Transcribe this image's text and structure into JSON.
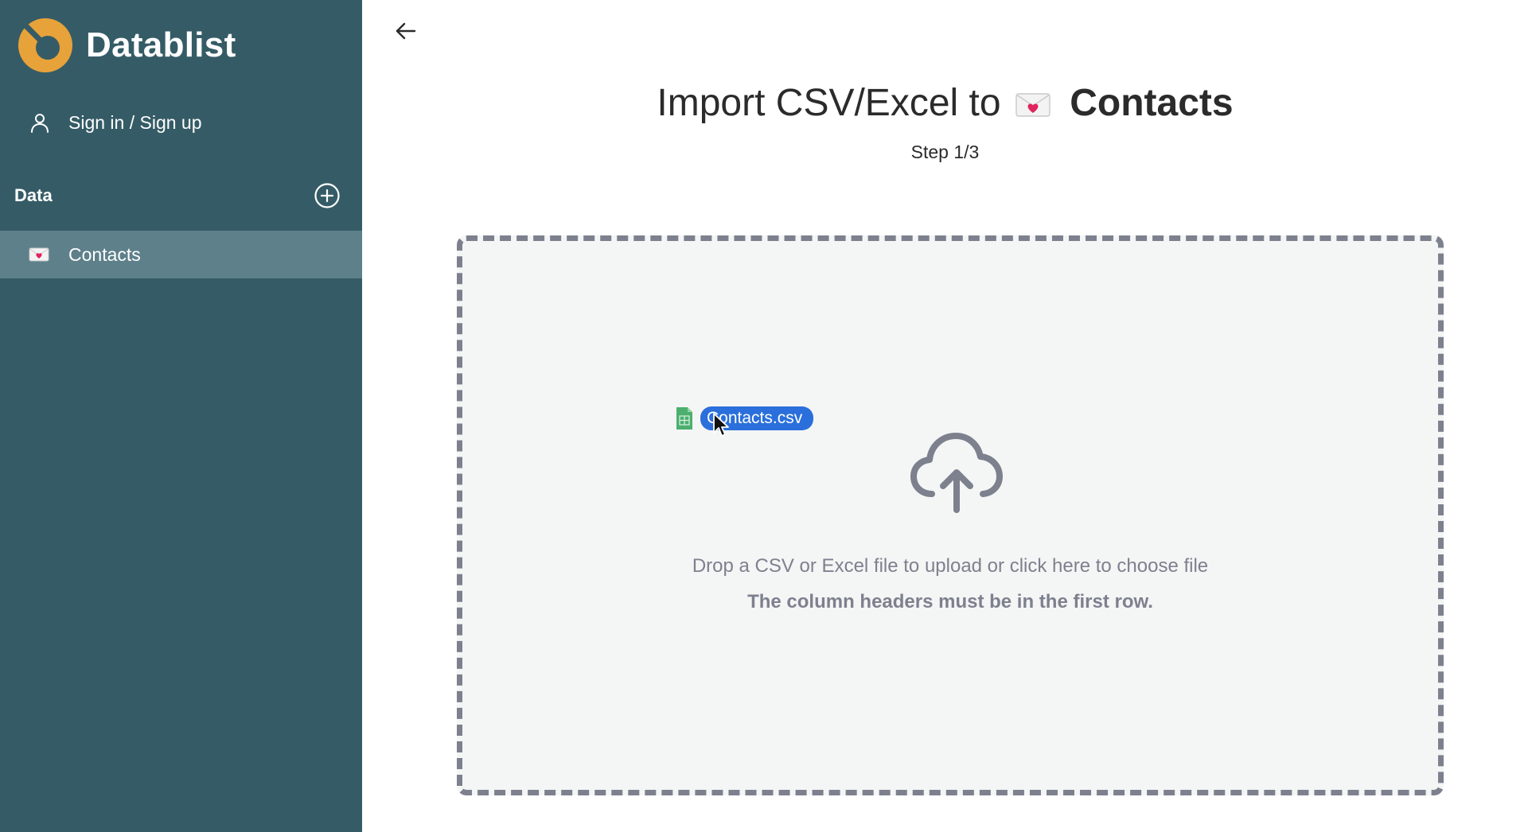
{
  "sidebar": {
    "brand_name": "Datablist",
    "signin_label": "Sign in / Sign up",
    "section_title": "Data",
    "items": [
      {
        "label": "Contacts",
        "icon": "love-letter-emoji"
      }
    ]
  },
  "main": {
    "title_prefix": "Import CSV/Excel to",
    "title_target": "Contacts",
    "step_label": "Step 1/3",
    "dropzone": {
      "text": "Drop a CSV or Excel file to upload or click here to choose file",
      "note": "The column headers must be in the first row."
    },
    "dragged_file": "Contacts.csv"
  },
  "colors": {
    "sidebar_bg": "#355c66",
    "sidebar_active": "#5e808a",
    "brand_orange": "#e8a23a",
    "dropzone_border": "#7d818e",
    "dropzone_bg": "#f4f5f5",
    "file_chip": "#2a6fdb"
  }
}
